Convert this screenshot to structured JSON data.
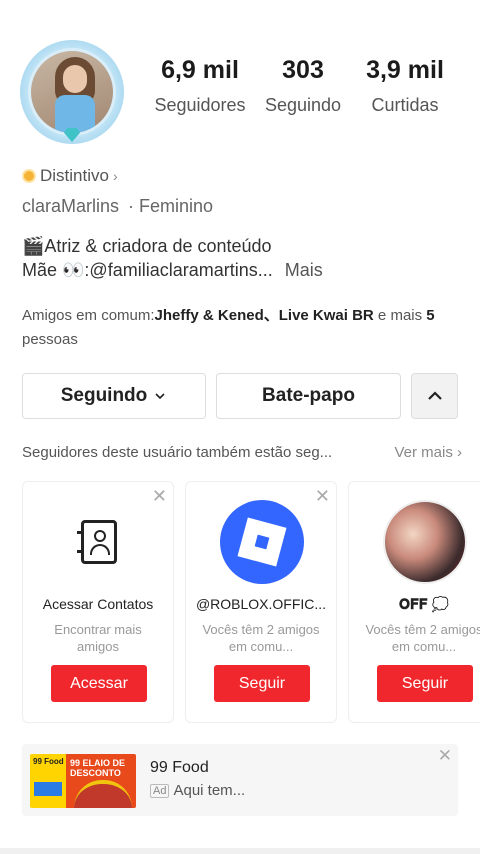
{
  "profile": {
    "stats": [
      {
        "value": "6,9 mil",
        "label": "Seguidores"
      },
      {
        "value": "303",
        "label": "Seguindo"
      },
      {
        "value": "3,9 mil",
        "label": "Curtidas"
      }
    ],
    "badge_label": "Distintivo",
    "username": "claraMarlins",
    "gender": "· Feminino",
    "bio_line1": "🎬Atriz & criadora de conteúdo",
    "bio_line2": "Mãe 👀:@familiaclaramartins...",
    "bio_more": "Mais",
    "mutual_prefix": "Amigos em comum:",
    "mutual_names": "Jheffy & Kened、Live Kwai BR",
    "mutual_mid": " e mais ",
    "mutual_count": "5",
    "mutual_suffix": " pessoas"
  },
  "actions": {
    "following_label": "Seguindo",
    "chat_label": "Bate-papo"
  },
  "suggestions": {
    "heading": "Seguidores deste usuário também estão seg...",
    "see_more": "Ver mais",
    "cards": [
      {
        "name": "Acessar Contatos",
        "sub": "Encontrar mais amigos",
        "action": "Acessar"
      },
      {
        "name": "@ROBLOX.OFFIC...",
        "sub": "Vocês têm 2 amigos em comu...",
        "action": "Seguir"
      },
      {
        "name": "𝐎𝐅𝐅 💭",
        "sub": "Vocês têm 2 amigos em comu...",
        "action": "Seguir"
      }
    ]
  },
  "ad": {
    "title": "99 Food",
    "tag": "Ad",
    "subtitle": "Aqui tem...",
    "image_brand": "99 Food",
    "image_promo": "99 ELAIO DE DESCONTO"
  },
  "icons": {
    "close": "close-icon",
    "chevron_down": "chevron-down-icon",
    "chevron_up": "chevron-up-icon",
    "chevron_right": "chevron-right-icon"
  },
  "colors": {
    "accent": "#f0282d",
    "badge": "#f6b437",
    "roblox_blue": "#3366ff"
  }
}
